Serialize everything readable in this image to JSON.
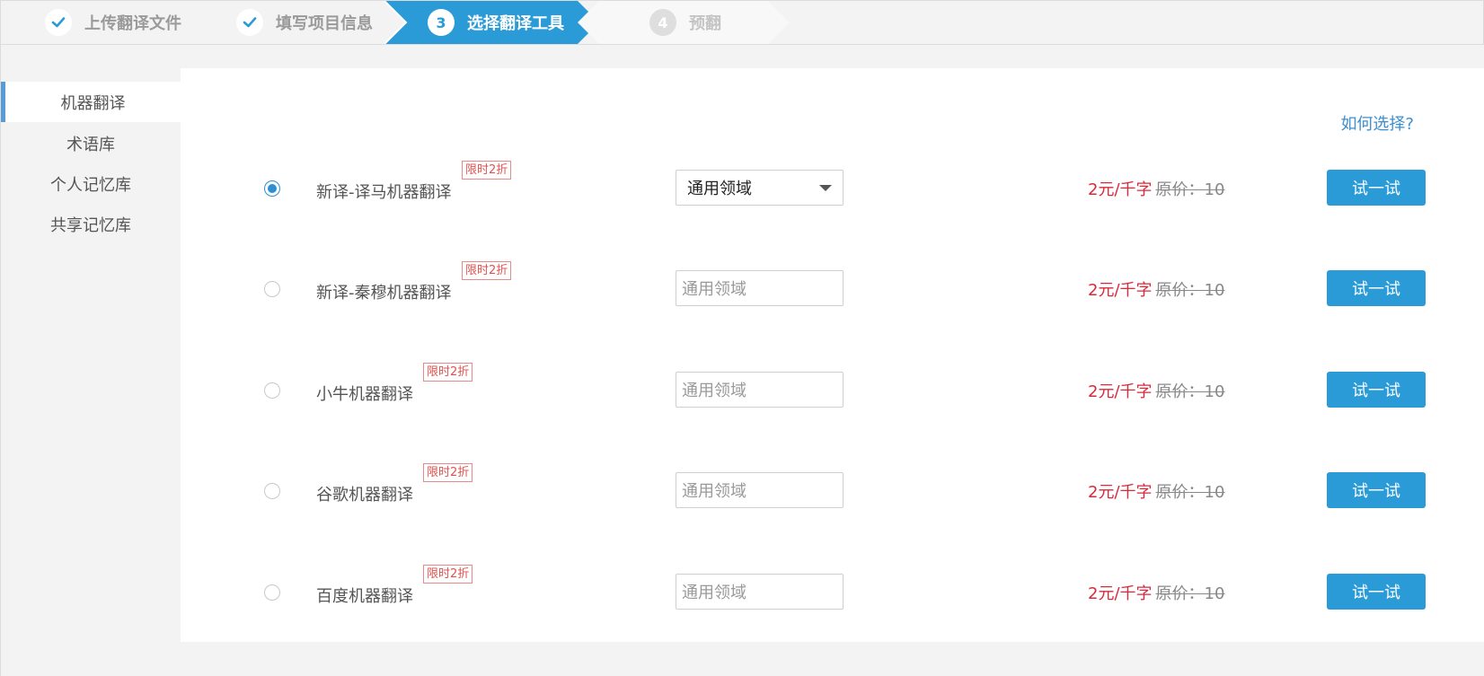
{
  "stepper": {
    "steps": [
      {
        "label": "上传翻译文件",
        "state": "done",
        "icon": "checkmark-icon"
      },
      {
        "label": "填写项目信息",
        "state": "done",
        "icon": "checkmark-icon"
      },
      {
        "number": "3",
        "label": "选择翻译工具",
        "state": "active"
      },
      {
        "number": "4",
        "label": "预翻",
        "state": "pending"
      }
    ],
    "active_color": "#2b9bd8"
  },
  "sidebar": {
    "items": [
      {
        "label": "机器翻译",
        "active": true
      },
      {
        "label": "术语库",
        "active": false
      },
      {
        "label": "个人记忆库",
        "active": false
      },
      {
        "label": "共享记忆库",
        "active": false
      }
    ],
    "active_indicator_color": "#5b9bd5"
  },
  "main": {
    "help_link": "如何选择?",
    "engines": [
      {
        "name": "新译-译马机器翻译",
        "badge": "限时2折",
        "selected": true,
        "domain": "通用领域",
        "domain_is_select": true,
        "price": "2元/千字",
        "original_price": "原价：10",
        "try_label": "试一试"
      },
      {
        "name": "新译-秦穆机器翻译",
        "badge": "限时2折",
        "selected": false,
        "domain": "通用领域",
        "domain_is_select": false,
        "price": "2元/千字",
        "original_price": "原价：10",
        "try_label": "试一试"
      },
      {
        "name": "小牛机器翻译",
        "badge": "限时2折",
        "selected": false,
        "domain": "通用领域",
        "domain_is_select": false,
        "price": "2元/千字",
        "original_price": "原价：10",
        "try_label": "试一试"
      },
      {
        "name": "谷歌机器翻译",
        "badge": "限时2折",
        "selected": false,
        "domain": "通用领域",
        "domain_is_select": false,
        "price": "2元/千字",
        "original_price": "原价：10",
        "try_label": "试一试"
      },
      {
        "name": "百度机器翻译",
        "badge": "限时2折",
        "selected": false,
        "domain": "通用领域",
        "domain_is_select": false,
        "price": "2元/千字",
        "original_price": "原价：10",
        "try_label": "试一试"
      }
    ],
    "price_color": "#d9293b",
    "button_color": "#2b9bd8"
  }
}
